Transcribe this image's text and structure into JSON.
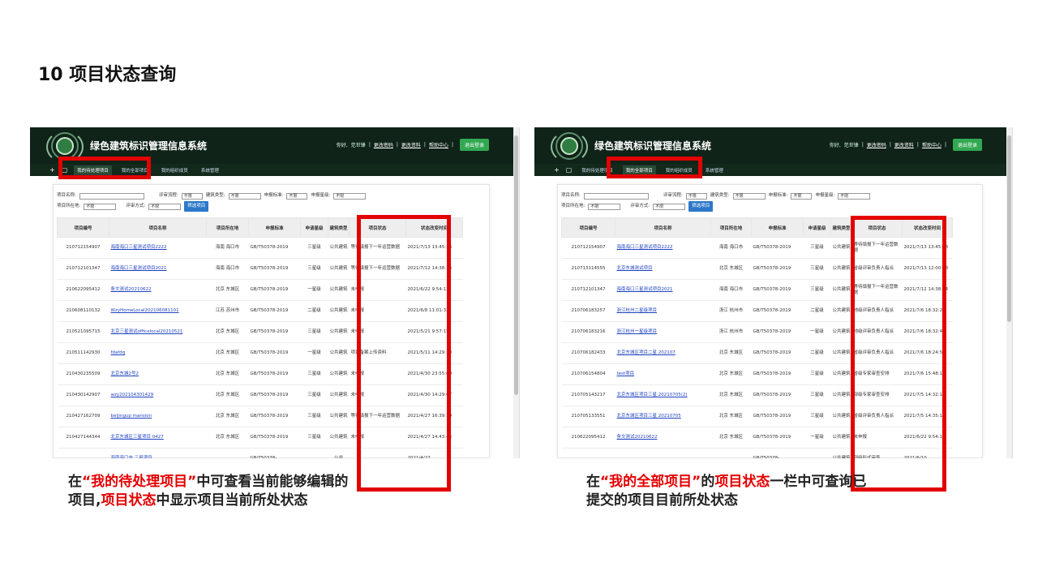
{
  "page": {
    "title": "10 项目状态查询"
  },
  "app": {
    "title": "绿色建筑标识管理信息系统",
    "greeting": "你好,",
    "user": "范世锋",
    "sep": "|",
    "change_password": "更改密码",
    "change_profile": "更改资料",
    "help": "帮助中心",
    "logout": "退出登录"
  },
  "nav": {
    "left": [
      "我的待处理项目",
      "我的全部项目",
      "我的组织成员",
      "系统管理"
    ],
    "right": [
      "我的待处理项目",
      "我的全部项目",
      "我的组织成员",
      "系统管理"
    ]
  },
  "filters": {
    "project_name": "项目名称:",
    "eval_process": "评审流程:",
    "building_type": "建筑类型:",
    "standard": "申报标准:",
    "level": "申报星级:",
    "location": "项目所在地:",
    "eval_method": "评审方式:",
    "any": "不限",
    "filter_button": "筛选项目"
  },
  "columns": {
    "id": "项目编号",
    "name": "项目名称",
    "location": "项目所在地",
    "standard": "申报标准",
    "level": "申请星级",
    "type": "建筑类型",
    "status": "项目状态",
    "time": "状态改变时间"
  },
  "left_rows": [
    {
      "id": "210712154907",
      "name": "海南海口三星测试项目2222",
      "loc": "海南 海口市",
      "std": "GB/T50378-2019",
      "lvl": "三星级",
      "type": "公共建筑",
      "status": "等待填报下一年运营数据",
      "time": "2021/7/13 13:45:33"
    },
    {
      "id": "210712101347",
      "name": "海南海口三星测试项目2021",
      "loc": "海南 海口市",
      "std": "GB/T50378-2019",
      "lvl": "三星级",
      "type": "公共建筑",
      "status": "等待填报下一年运营数据",
      "time": "2021/7/12 14:38:14"
    },
    {
      "id": "210622095412",
      "name": "条文测试20210622",
      "loc": "北京 东城区",
      "std": "GB/T50378-2019",
      "lvl": "一星级",
      "type": "公共建筑",
      "status": "未申报",
      "time": "2021/6/22 9:54:12"
    },
    {
      "id": "210608110132",
      "name": "WzyHomeLocal202106081101",
      "loc": "江苏 苏州市",
      "std": "GB/T50378-2019",
      "lvl": "二星级",
      "type": "公共建筑",
      "status": "未申报",
      "time": "2021/6/8 11:01:32"
    },
    {
      "id": "210521095715",
      "name": "北京三星测试officelocal20210521",
      "loc": "北京 东城区",
      "std": "GB/T50378-2019",
      "lvl": "三星级",
      "type": "公共建筑",
      "status": "未申报",
      "time": "2021/5/21 9:57:15"
    },
    {
      "id": "210511142930",
      "name": "fdafdq",
      "loc": "北京 东城区",
      "std": "GB/T50378-2019",
      "lvl": "一星级",
      "type": "公共建筑",
      "status": "项目备案上传资料",
      "time": "2021/5/11 14:29:30"
    },
    {
      "id": "210430235509",
      "name": "北京东城2号2",
      "loc": "北京 东城区",
      "std": "GB/T50378-2019",
      "lvl": "三星级",
      "type": "公共建筑",
      "status": "未申报",
      "time": "2021/4/30 23:55:09"
    },
    {
      "id": "210430142907",
      "name": "wzy202104301429",
      "loc": "北京 东城区",
      "std": "GB/T50378-2019",
      "lvl": "三星级",
      "type": "公共建筑",
      "status": "未申报",
      "time": "2021/4/30 14:29:07"
    },
    {
      "id": "210427162709",
      "name": "beijingup mansion",
      "loc": "北京 东城区",
      "std": "GB/T50378-2019",
      "lvl": "三星级",
      "type": "公共建筑",
      "status": "等待填报下一年运营数据",
      "time": "2021/4/27 16:39:19"
    },
    {
      "id": "210427144344",
      "name": "北京东城区三星项目 0427",
      "loc": "北京 东城区",
      "std": "GB/T50378-2019",
      "lvl": "三星级",
      "type": "公共建筑",
      "status": "未申报",
      "time": "2021/4/27 14:43:44"
    },
    {
      "id": "",
      "name": "海南海口市 三星项目",
      "loc": "",
      "std": "GB/T50378-",
      "lvl": "",
      "type": "公共",
      "status": "",
      "time": "2021/4/27"
    }
  ],
  "right_rows": [
    {
      "id": "210712154907",
      "name": "海南海口三星测试项目2222",
      "loc": "海南 海口市",
      "std": "GB/T50378-2019",
      "lvl": "三星级",
      "type": "公共建筑",
      "status": "等待填报下一年运营数据",
      "time": "2021/7/13 13:45:33"
    },
    {
      "id": "210713114555",
      "name": "北京东城测试项目",
      "loc": "北京 东城区",
      "std": "GB/T50378-2019",
      "lvl": "三星级",
      "type": "公共建筑",
      "status": "省级评审负责人指派",
      "time": "2021/7/13 12:00:18"
    },
    {
      "id": "210712101347",
      "name": "海南海口三星测试项目2021",
      "loc": "海南 海口市",
      "std": "GB/T50378-2019",
      "lvl": "三星级",
      "type": "公共建筑",
      "status": "等待填报下一年运营数据",
      "time": "2021/7/12 14:38:14"
    },
    {
      "id": "210706183257",
      "name": "浙江杭州二星级项目",
      "loc": "浙江 杭州市",
      "std": "GB/T50378-2019",
      "lvl": "二星级",
      "type": "公共建筑",
      "status": "地级评审负责人指派",
      "time": "2021/7/6 18:32:21"
    },
    {
      "id": "210706183216",
      "name": "浙江杭州一星级项目",
      "loc": "浙江 杭州市",
      "std": "GB/T50378-2019",
      "lvl": "一星级",
      "type": "公共建筑",
      "status": "地级评审负责人指派",
      "time": "2021/7/6 18:32:41"
    },
    {
      "id": "210706182433",
      "name": "北京东城区项目二星 202107",
      "loc": "北京 东城区",
      "std": "GB/T50378-2019",
      "lvl": "二星级",
      "type": "公共建筑",
      "status": "省级评审负责人指派",
      "time": "2021/7/6 18:24:58"
    },
    {
      "id": "210706154804",
      "name": "test项目",
      "loc": "北京 东城区",
      "std": "GB/T50378-2019",
      "lvl": "三星级",
      "type": "公共建筑",
      "status": "省级专家审查安排",
      "time": "2021/7/6 15:48:11"
    },
    {
      "id": "210705143217",
      "name": "北京东城区项目三星 20210705(2)",
      "loc": "北京 东城区",
      "std": "GB/T50378-2019",
      "lvl": "三星级",
      "type": "公共建筑",
      "status": "部级专家审查安排",
      "time": "2021/7/5 14:32:12"
    },
    {
      "id": "210705133551",
      "name": "北京东城区项目三星 20210705",
      "loc": "北京 东城区",
      "std": "GB/T50378-2019",
      "lvl": "三星级",
      "type": "公共建筑",
      "status": "省级评审负责人指派",
      "time": "2021/7/5 14:35:12"
    },
    {
      "id": "210622095412",
      "name": "条文测试20210622",
      "loc": "北京 东城区",
      "std": "GB/T50378-2019",
      "lvl": "一星级",
      "type": "公共建筑",
      "status": "未申报",
      "time": "2021/6/22 9:54:12"
    },
    {
      "id": "",
      "name": "",
      "loc": "",
      "std": "GB/T50378-",
      "lvl": "",
      "type": "公共建筑",
      "status": "部级形式审查",
      "time": "2021/6/10"
    }
  ],
  "captions": {
    "left_1": "在",
    "left_2": "“我的待处理项目”",
    "left_3": "中可查看当前能够编辑的",
    "left_4": "项目,",
    "left_5": "项目状态",
    "left_6": "中显示项目当前所处状态",
    "right_1": "在",
    "right_2": "“我的全部项目”",
    "right_3": "的",
    "right_4": "项目状态",
    "right_5": "一栏中可查询已",
    "right_6": "提交的项目目前所处状态"
  }
}
